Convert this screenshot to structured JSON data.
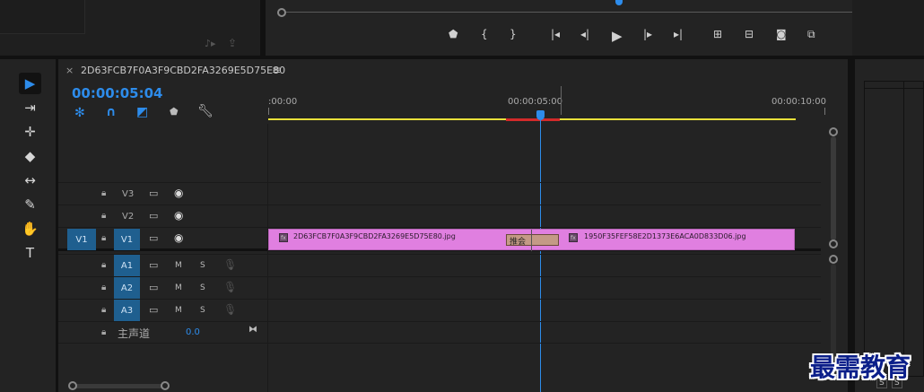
{
  "program_monitor": {
    "controls": [
      {
        "name": "add-marker-button",
        "glyph": "⬟"
      },
      {
        "name": "mark-in-button",
        "glyph": "{"
      },
      {
        "name": "mark-out-button",
        "glyph": "}"
      },
      {
        "name": "go-to-in-button",
        "glyph": "|◂"
      },
      {
        "name": "step-back-button",
        "glyph": "◂|"
      },
      {
        "name": "play-button",
        "glyph": "▶"
      },
      {
        "name": "step-forward-button",
        "glyph": "|▸"
      },
      {
        "name": "go-to-out-button",
        "glyph": "▸|"
      },
      {
        "name": "lift-button",
        "glyph": "⊞"
      },
      {
        "name": "extract-button",
        "glyph": "⊟"
      },
      {
        "name": "export-frame-button",
        "glyph": "◙"
      },
      {
        "name": "comparison-view-button",
        "glyph": "⧉"
      }
    ]
  },
  "tools": [
    {
      "name": "selection-tool-icon",
      "glyph": "▶",
      "active": true
    },
    {
      "name": "track-select-tool-icon",
      "glyph": "⇥"
    },
    {
      "name": "ripple-edit-tool-icon",
      "glyph": "✛"
    },
    {
      "name": "razor-tool-icon",
      "glyph": "◆"
    },
    {
      "name": "slip-tool-icon",
      "glyph": "↔"
    },
    {
      "name": "pen-tool-icon",
      "glyph": "✎"
    },
    {
      "name": "hand-tool-icon",
      "glyph": "✋"
    },
    {
      "name": "type-tool-icon",
      "glyph": "T"
    }
  ],
  "sequence": {
    "close": "×",
    "title": "2D63FCB7F0A3F9CBD2FA3269E5D75E80",
    "menu": "≡",
    "timecode": "00:00:05:04"
  },
  "ruler": {
    "labels": [
      ":00:00",
      "00:00:05:00",
      "00:00:10:00"
    ]
  },
  "video_tracks": [
    {
      "source": "",
      "name": "V3"
    },
    {
      "source": "",
      "name": "V2"
    },
    {
      "source": "V1",
      "name": "V1"
    }
  ],
  "audio_tracks": [
    {
      "name": "A1",
      "mute": "M",
      "solo": "S"
    },
    {
      "name": "A2",
      "mute": "M",
      "solo": "S"
    },
    {
      "name": "A3",
      "mute": "M",
      "solo": "S"
    }
  ],
  "master": {
    "label": "主声道",
    "value": "0.0"
  },
  "clips": [
    {
      "name": "2D63FCB7F0A3F9CBD2FA3269E5D75E80.jpg"
    },
    {
      "name": "1950F35FEF58E2D1373E6ACA0D833D06.jpg"
    }
  ],
  "transition": {
    "label": "推会"
  },
  "right_panel": {
    "s1": "S",
    "s2": "S"
  },
  "watermark": "最需教育",
  "colors": {
    "timecode": "#2d8ceb",
    "clip": "#e07fe0",
    "playhead": "#2d8ceb",
    "work_area": "#e8e03a",
    "track_target": "#1f5f8f"
  }
}
